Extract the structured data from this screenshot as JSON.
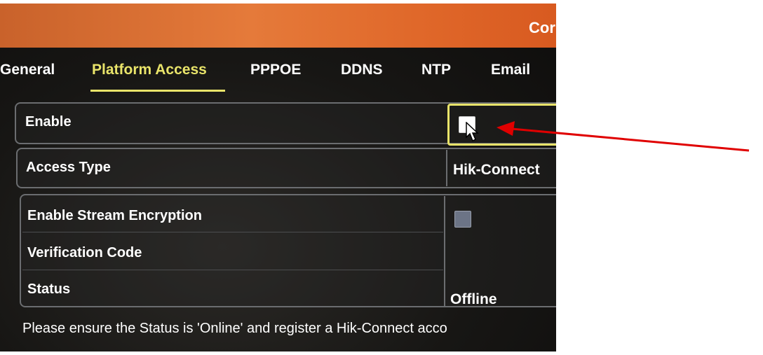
{
  "window": {
    "title_partial": "Cor"
  },
  "tabs": [
    {
      "label": "General"
    },
    {
      "label": "Platform Access",
      "active": true
    },
    {
      "label": "PPPOE"
    },
    {
      "label": "DDNS"
    },
    {
      "label": "NTP"
    },
    {
      "label": "Email"
    }
  ],
  "form": {
    "enable": {
      "label": "Enable",
      "checked": true
    },
    "access_type": {
      "label": "Access Type",
      "value": "Hik-Connect"
    },
    "stream_encryption": {
      "label": "Enable Stream Encryption",
      "checked": false
    },
    "verification_code": {
      "label": "Verification Code",
      "value": ""
    },
    "status": {
      "label": "Status",
      "value": "Offline"
    }
  },
  "hint": {
    "text": "Please ensure the Status is 'Online' and register a Hik-Connect acco"
  },
  "colors": {
    "accent_yellow": "#e9e46a",
    "titlebar_orange": "#e57a3a",
    "annotation_arrow": "#e00000"
  },
  "annotation": {
    "type": "arrow",
    "points_to": "enable-checkbox"
  }
}
